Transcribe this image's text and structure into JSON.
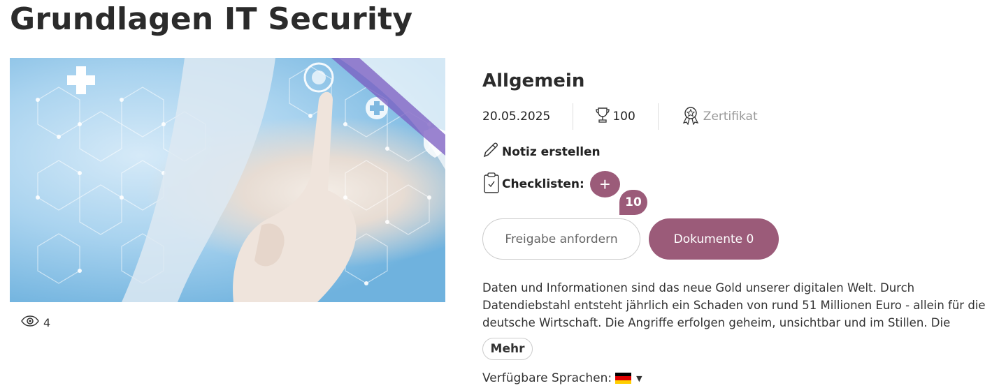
{
  "page": {
    "title": "Grundlagen IT Security"
  },
  "hero": {
    "views": "4"
  },
  "info": {
    "section_title": "Allgemein",
    "date": "20.05.2025",
    "points": "100",
    "certificate": "Zertifikat",
    "note_link": "Notiz erstellen",
    "checklists_label": "Checklisten:",
    "badge_count": "10",
    "request_button": "Freigabe anfordern",
    "documents_button": "Dokumente 0",
    "description_lines": [
      "Daten und Informationen sind das neue Gold unserer digitalen Welt. Durch",
      "Datendiebstahl entsteht jährlich ein Schaden von rund 51 Millionen Euro - allein für die",
      "deutsche Wirtschaft. Die Angriffe erfolgen geheim, unsichtbar und im Stillen. Die"
    ],
    "more_button": "Mehr",
    "languages_label": "Verfügbare Sprachen:"
  },
  "colors": {
    "accent": "#9b5b79"
  },
  "icons": [
    "eye-icon",
    "trophy-icon",
    "award-icon",
    "pencil-icon",
    "clipboard-icon",
    "plus-icon",
    "caret-down-icon"
  ]
}
